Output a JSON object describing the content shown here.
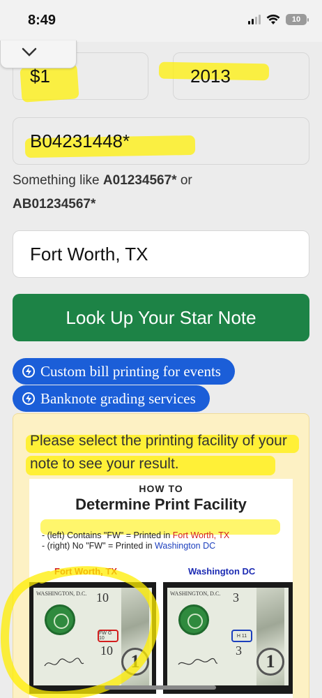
{
  "status_bar": {
    "time": "8:49",
    "battery": "10"
  },
  "form": {
    "denomination": "$1",
    "series_year": "2013",
    "serial_number": "B04231448*",
    "hint_prefix": "Something like ",
    "hint_example_1": "A01234567*",
    "hint_or": " or",
    "hint_example_2": "AB01234567*",
    "location": "Fort Worth, TX",
    "lookup_button": "Look Up Your Star Note"
  },
  "services": [
    {
      "label": "Custom bill printing for events",
      "icon": "lightning-circle-icon"
    },
    {
      "label": "Banknote grading services",
      "icon": "lightning-circle-icon"
    }
  ],
  "result": {
    "message": "Please select the printing facility of your note to see your result."
  },
  "guide": {
    "how_to": "HOW TO",
    "title": "Determine Print Facility",
    "line1_prefix": "- (left) Contains \"FW\" = Printed in ",
    "line1_place": "Fort Worth, TX",
    "line2_prefix": "- (right) No \"FW\" = Printed in ",
    "line2_place": "Washington DC",
    "left_label": "Fort Worth, TX",
    "right_label": "Washington DC",
    "left_bill": {
      "header": "WASHINGTON, D.C.",
      "num_top": "10",
      "num_bottom": "10",
      "code": "FW G 10",
      "corner": "1"
    },
    "right_bill": {
      "header": "WASHINGTON, D.C.",
      "num_top": "3",
      "num_bottom": "3",
      "code": "H 11",
      "corner": "1"
    }
  },
  "colors": {
    "highlight": "#fff000",
    "lookup_green": "#1d8346",
    "pill_blue": "#1b5ed8",
    "panel_bg": "#fdf1c4",
    "fw_red": "#d31d1d",
    "dc_blue": "#1c2bb3"
  }
}
